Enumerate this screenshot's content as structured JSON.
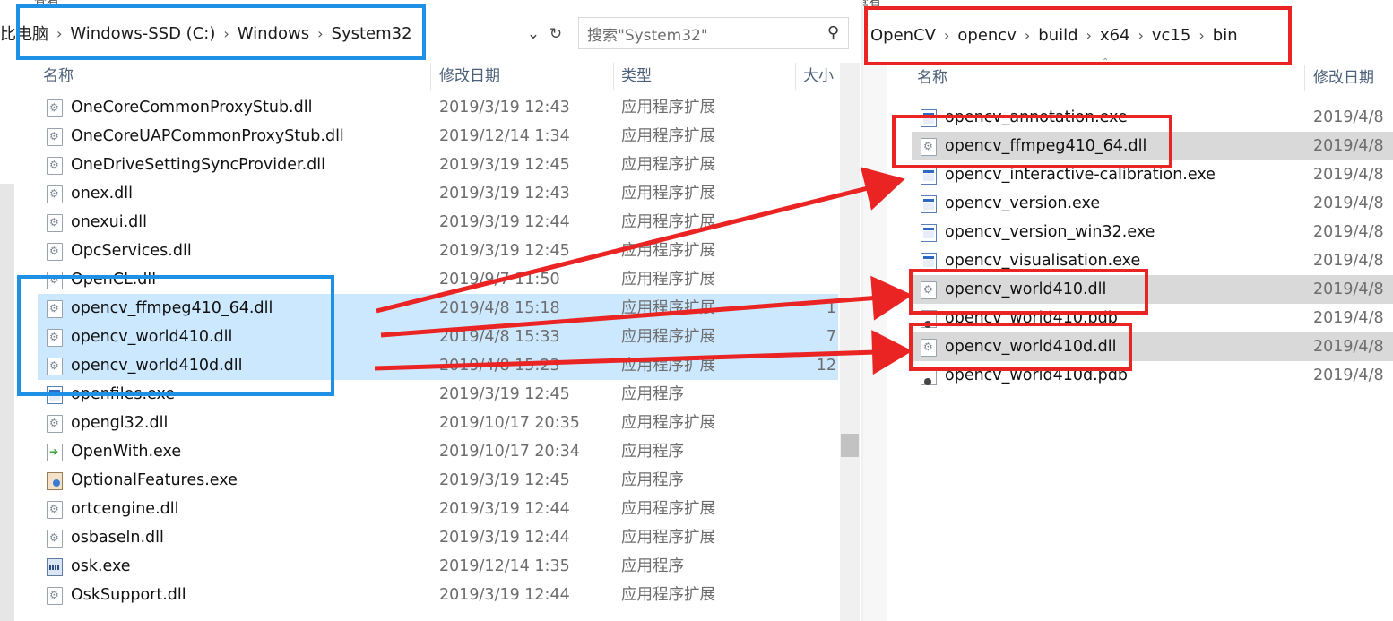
{
  "left": {
    "tiny_top": "查看",
    "breadcrumb": [
      "比电脑",
      "Windows-SSD (C:)",
      "Windows",
      "System32"
    ],
    "search_placeholder": "搜索\"System32\"",
    "headers": {
      "name": "名称",
      "date": "修改日期",
      "type": "类型",
      "size": "大小"
    },
    "files": [
      {
        "name": "OneCoreCommonProxyStub.dll",
        "date": "2019/3/19 12:43",
        "type": "应用程序扩展",
        "size": "",
        "icon": "dll-icon"
      },
      {
        "name": "OneCoreUAPCommonProxyStub.dll",
        "date": "2019/12/14 1:34",
        "type": "应用程序扩展",
        "size": "",
        "icon": "dll-icon"
      },
      {
        "name": "OneDriveSettingSyncProvider.dll",
        "date": "2019/3/19 12:45",
        "type": "应用程序扩展",
        "size": "",
        "icon": "dll-icon"
      },
      {
        "name": "onex.dll",
        "date": "2019/3/19 12:43",
        "type": "应用程序扩展",
        "size": "",
        "icon": "dll-icon"
      },
      {
        "name": "onexui.dll",
        "date": "2019/3/19 12:44",
        "type": "应用程序扩展",
        "size": "",
        "icon": "dll-icon"
      },
      {
        "name": "OpcServices.dll",
        "date": "2019/3/19 12:45",
        "type": "应用程序扩展",
        "size": "",
        "icon": "dll-icon"
      },
      {
        "name": "OpenCL.dll",
        "date": "2019/9/7 11:50",
        "type": "应用程序扩展",
        "size": "",
        "icon": "dll-icon"
      },
      {
        "name": "opencv_ffmpeg410_64.dll",
        "date": "2019/4/8 15:18",
        "type": "应用程序扩展",
        "size": "1",
        "icon": "dll-icon",
        "selected": true
      },
      {
        "name": "opencv_world410.dll",
        "date": "2019/4/8 15:33",
        "type": "应用程序扩展",
        "size": "7",
        "icon": "dll-icon",
        "selected": true
      },
      {
        "name": "opencv_world410d.dll",
        "date": "2019/4/8 15:23",
        "type": "应用程序扩展",
        "size": "12",
        "icon": "dll-icon",
        "selected": true
      },
      {
        "name": "openfiles.exe",
        "date": "2019/3/19 12:45",
        "type": "应用程序",
        "size": "",
        "icon": "exe-icon"
      },
      {
        "name": "opengl32.dll",
        "date": "2019/10/17 20:35",
        "type": "应用程序扩展",
        "size": "",
        "icon": "dll-icon"
      },
      {
        "name": "OpenWith.exe",
        "date": "2019/10/17 20:34",
        "type": "应用程序",
        "size": "",
        "icon": "openwith-icon"
      },
      {
        "name": "OptionalFeatures.exe",
        "date": "2019/3/19 12:45",
        "type": "应用程序",
        "size": "",
        "icon": "optionalfeatures-icon"
      },
      {
        "name": "ortcengine.dll",
        "date": "2019/3/19 12:44",
        "type": "应用程序扩展",
        "size": "",
        "icon": "dll-icon"
      },
      {
        "name": "osbaseln.dll",
        "date": "2019/3/19 12:44",
        "type": "应用程序扩展",
        "size": "",
        "icon": "dll-icon"
      },
      {
        "name": "osk.exe",
        "date": "2019/12/14 1:35",
        "type": "应用程序",
        "size": "",
        "icon": "keyboard-icon"
      },
      {
        "name": "OskSupport.dll",
        "date": "2019/3/19 12:44",
        "type": "应用程序扩展",
        "size": "",
        "icon": "dll-icon"
      }
    ]
  },
  "right": {
    "tiny_top": "查看",
    "breadcrumb": [
      "OpenCV",
      "opencv",
      "build",
      "x64",
      "vc15",
      "bin"
    ],
    "headers": {
      "name": "名称",
      "date": "修改日期"
    },
    "files": [
      {
        "name": "opencv_annotation.exe",
        "date": "2019/4/8",
        "icon": "exe-icon"
      },
      {
        "name": "opencv_ffmpeg410_64.dll",
        "date": "2019/4/8",
        "icon": "dll-icon",
        "selected": true
      },
      {
        "name": "opencv_interactive-calibration.exe",
        "date": "2019/4/8",
        "icon": "exe-icon"
      },
      {
        "name": "opencv_version.exe",
        "date": "2019/4/8",
        "icon": "exe-icon"
      },
      {
        "name": "opencv_version_win32.exe",
        "date": "2019/4/8",
        "icon": "exe-icon"
      },
      {
        "name": "opencv_visualisation.exe",
        "date": "2019/4/8",
        "icon": "exe-icon"
      },
      {
        "name": "opencv_world410.dll",
        "date": "2019/4/8",
        "icon": "dll-icon",
        "selected": true
      },
      {
        "name": "opencv_world410.pdb",
        "date": "2019/4/8",
        "icon": "pdb-icon"
      },
      {
        "name": "opencv_world410d.dll",
        "date": "2019/4/8",
        "icon": "dll-icon",
        "selected": true
      },
      {
        "name": "opencv_world410d.pdb",
        "date": "2019/4/8",
        "icon": "pdb-icon"
      }
    ]
  },
  "colors": {
    "highlight_blue": "#1e90e6",
    "highlight_red": "#ea2323",
    "selection": "#cce8ff",
    "selection_gray": "#d9d9d9"
  }
}
